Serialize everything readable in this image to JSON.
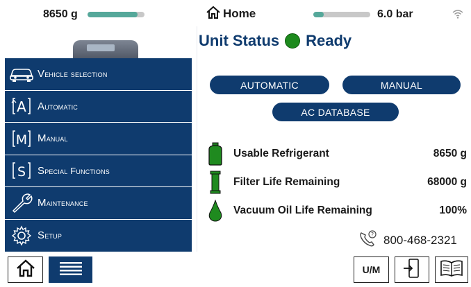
{
  "topbar": {
    "weight_text": "8650 g",
    "weight_level": 0.88,
    "home_label": "Home",
    "pressure_level": 0.18,
    "pressure_text": "6.0 bar",
    "icons": {
      "home": "home-icon",
      "wifi": "wifi-icon"
    }
  },
  "sidebar": {
    "items": [
      {
        "label": "Vehicle selection",
        "icon": "car-icon"
      },
      {
        "label": "Automatic",
        "icon": "automatic-a-icon"
      },
      {
        "label": "Manual",
        "icon": "manual-m-icon"
      },
      {
        "label": "Special Functions",
        "icon": "special-s-icon"
      },
      {
        "label": "Maintenance",
        "icon": "wrench-icon"
      },
      {
        "label": "Setup",
        "icon": "gear-icon"
      }
    ]
  },
  "main": {
    "status_title": "Unit Status",
    "status_value": "Ready",
    "status_color": "#1d8a1d",
    "buttons": {
      "automatic": "AUTOMATIC",
      "manual": "MANUAL",
      "ac_database": "AC DATABASE"
    },
    "info": [
      {
        "label": "Usable Refrigerant",
        "value": "8650 g",
        "icon": "refrigerant-tank-icon"
      },
      {
        "label": "Filter Life Remaining",
        "value": "68000 g",
        "icon": "filter-icon"
      },
      {
        "label": "Vacuum Oil Life Remaining",
        "value": "100%",
        "icon": "oil-drop-icon"
      }
    ],
    "phone": "800-468-2321"
  },
  "bottombar": {
    "um_label": "U/M",
    "icons": [
      "home-icon",
      "menu-icon",
      "exit-icon",
      "manual-book-icon"
    ]
  },
  "colors": {
    "navy": "#0f3b6e",
    "green": "#1d8a1d",
    "bar_fill": "#55a89a",
    "bar_track": "#c8c8c8"
  }
}
